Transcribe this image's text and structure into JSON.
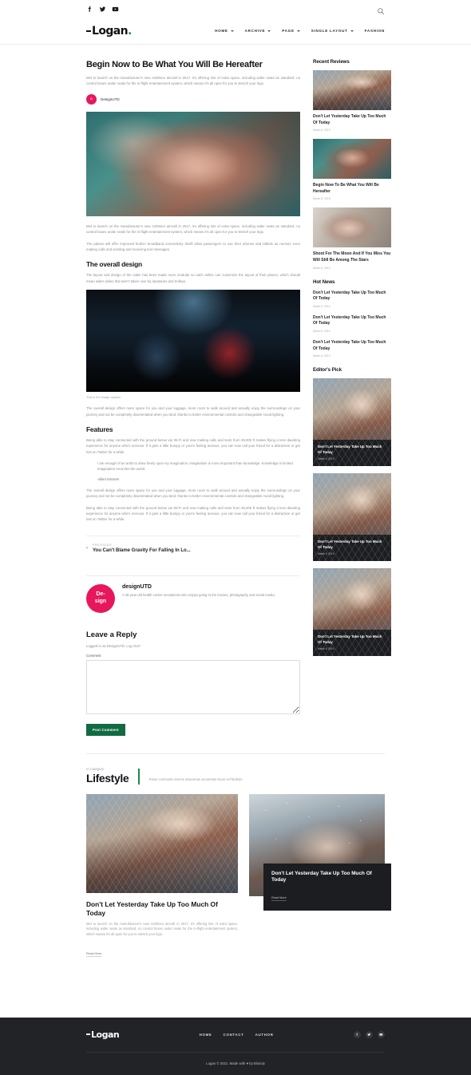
{
  "topbar": {
    "social": [
      "facebook-icon",
      "twitter-icon",
      "youtube-icon"
    ],
    "search": "search-icon"
  },
  "header": {
    "logo": "Logan",
    "logo_dot": ".",
    "nav": [
      {
        "label": "HOME",
        "has_caret": true
      },
      {
        "label": "ARCHIVE",
        "has_caret": true
      },
      {
        "label": "PAGE",
        "has_caret": true
      },
      {
        "label": "SINGLE LAYOUT",
        "has_caret": true
      },
      {
        "label": "FASHION",
        "has_caret": false
      }
    ]
  },
  "article": {
    "title": "Begin Now to Be What You Will Be Hereafter",
    "excerpt": "Met to launch on the manufacturer's new A330neo aircraft in 2017, it's offering lots of extra space, including wider seats as standard, no control boxes under seats for the in-flight entertainment system, which means it's all open for you to stretch your legs.",
    "author_initials": "D",
    "author": "DesignUTD",
    "paragraph_1": "Met to launch on the manufacturer's new A330neo aircraft in 2017, it's offering lots of extra space, including wider seats as standard, no control boxes under seats for the in-flight entertainment system, which means it's all open for you to stretch your legs.",
    "paragraph_2": "The planes will offer improved built-in broadband connectivity that'll allow passengers to use their phones and tablets as normal, even making calls and sending and receiving text messages.",
    "heading_design": "The overall design",
    "paragraph_3": "The layout and design of the cabin has been made more modular so each airline can customize the layout of their planes, which should mean wider aisles that aren't taken over by lavatories and trolleys.",
    "image_caption": "This is the image caption",
    "paragraph_4": "The overall design offers more space for you and your luggage, more room to walk around and actually enjoy the surroundings on your journey and not be completely disorientated when you land, thanks to better environmental controls and changeable mood lighting.",
    "heading_features": "Features",
    "paragraph_5": "Being able to stay connected with the ground below via Wi-Fi and now making calls and texts from 35,000 ft makes flying a less daunting experience for anyone who's nervous. If it gets a little bumpy or you're feeling anxious, you can now call your friend for a distraction or get lost on Twitter for a while.",
    "quote": "I am enough of an artist to draw freely upon my imagination. Imagination is more important than knowledge. Knowledge is limited. Imagination encircles the world.",
    "quote_author": "Albert Einstein",
    "paragraph_6": "The overall design offers more space for you and your luggage, more room to walk around and actually enjoy the surroundings on your journey and not be completely disorientated when you land, thanks to better environmental controls and changeable mood lighting.",
    "paragraph_7": "Being able to stay connected with the ground below via Wi-Fi and now making calls and texts from 35,000 ft makes flying a less daunting experience for anyone who's nervous. If it gets a little bumpy or you're feeling anxious, you can now call your friend for a distraction or get lost on Twitter for a while."
  },
  "prev_nav": {
    "label": "PREVIOUS",
    "title": "You Can't Blame Gravity For Falling In Lo..."
  },
  "author_box": {
    "initials": "De-\nsign",
    "name": "designUTD",
    "bio": "A 26-year-old health centre receptionist who enjoys going to the movies, photography and social media."
  },
  "comments": {
    "heading": "Leave a Reply",
    "logged_in": "Logged in as DesignUTD. Log Out?",
    "comment_label": "Comment",
    "comment_value": "",
    "submit_label": "Post Comment"
  },
  "sidebar": {
    "recent_reviews": {
      "heading": "Recent Reviews",
      "items": [
        {
          "title": "Don't Let Yesterday Take Up Too Much Of Today",
          "date": "March 6, 2019",
          "image": "rooftop"
        },
        {
          "title": "Begin Now To Be What You Will Be Hereafter",
          "date": "March 6, 2019",
          "image": "embrace"
        },
        {
          "title": "Shoot For The Moon And If You Miss You Will Still Be Among The Stars",
          "date": "March 6, 2019",
          "image": "sleep"
        }
      ]
    },
    "hot_news": {
      "heading": "Hot News",
      "items": [
        {
          "title": "Don't Let Yesterday Take Up Too Much Of Today",
          "date": "March 6, 2019"
        },
        {
          "title": "Don't Let Yesterday Take Up Too Much Of Today",
          "date": "March 6, 2019"
        },
        {
          "title": "Don't Let Yesterday Take Up Too Much Of Today",
          "date": "March 6, 2019"
        }
      ]
    },
    "editors_pick": {
      "heading": "Editor's Pick",
      "items": [
        {
          "title": "Don't Let Yesterday Take Up Too Much Of Today",
          "date": "March 6, 2019"
        },
        {
          "title": "Don't Let Yesterday Take Up Too Much Of Today",
          "date": "March 6, 2019"
        },
        {
          "title": "Don't Let Yesterday Take Up Too Much Of Today",
          "date": "March 6, 2019"
        }
      ]
    }
  },
  "category": {
    "eyebrow": "In Category",
    "name": "Lifestyle",
    "description": "Risus commodo viverra maecenas accumsan lacus vel facilisis."
  },
  "cards": {
    "left": {
      "title": "Don't Let Yesterday Take Up Too Much Of Today",
      "excerpt": "Met to launch on the manufacturer's new A330neo aircraft in 2017, it's offering lots of extra space, including wider seats as standard, no control boxes under seats for the in-flight entertainment system, which means it's all open for you to stretch your legs.",
      "read_more": "Read More"
    },
    "right": {
      "title": "Don't Let Yesterday Take Up Too Much Of Today",
      "read_more": "Read More"
    }
  },
  "footer": {
    "logo": "Logan",
    "nav": [
      "HOME",
      "CONTACT",
      "AUTHOR"
    ],
    "social": [
      "facebook-icon",
      "twitter-icon",
      "youtube-icon"
    ],
    "copyright": "Logan © 2021. Made with ♥ by Bloimjs"
  },
  "colors": {
    "accent_green": "#1f8a4c",
    "button_green": "#116b42",
    "avatar_pink": "#e8175d",
    "dark": "#212326"
  }
}
